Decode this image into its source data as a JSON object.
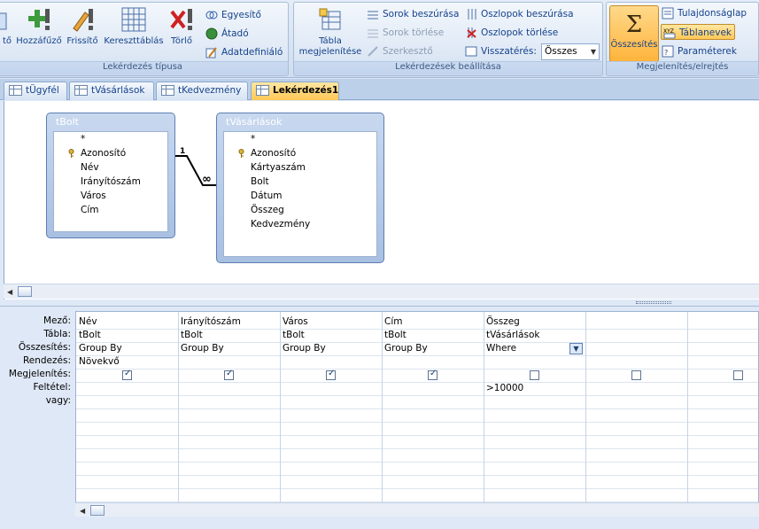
{
  "ribbon": {
    "group1": {
      "label": "Lekérdezés típusa",
      "buttons": [
        "tő",
        "Hozzáfűző",
        "Frissítő",
        "Kereszttáblás",
        "Törlő"
      ],
      "small": [
        "Egyesítő",
        "Átadó",
        "Adatdefiniáló"
      ]
    },
    "group2": {
      "label": "Lekérdezések beállítása",
      "big": "Tábla megjelenítése",
      "big_line1": "Tábla",
      "big_line2": "megjelenítése",
      "small": [
        "Sorok beszúrása",
        "Sorok törlése",
        "Szerkesztő",
        "Oszlopok beszúrása",
        "Oszlopok törlése",
        "Visszatérés:"
      ],
      "return_value": "Összes"
    },
    "group3": {
      "label": "Megjelenítés/elrejtés",
      "big": "Összesítés",
      "small": [
        "Tulajdonságlap",
        "Táblanevek",
        "Paraméterek"
      ]
    }
  },
  "tabs": [
    "tÜgyfél",
    "tVásárlások",
    "tKedvezmény",
    "Lekérdezés1"
  ],
  "tables": {
    "tBolt": {
      "title": "tBolt",
      "fields": [
        "*",
        "Azonosító",
        "Név",
        "Irányítószám",
        "Város",
        "Cím"
      ]
    },
    "tVasarlasok": {
      "title": "tVásárlások",
      "fields": [
        "*",
        "Azonosító",
        "Kártyaszám",
        "Bolt",
        "Dátum",
        "Összeg",
        "Kedvezmény"
      ]
    }
  },
  "relation": {
    "one": "1",
    "many": "∞"
  },
  "grid": {
    "row_labels": [
      "Mező:",
      "Tábla:",
      "Összesítés:",
      "Rendezés:",
      "Megjelenítés:",
      "Feltétel:",
      "vagy:"
    ],
    "columns": [
      {
        "field": "Név",
        "table": "tBolt",
        "total": "Group By",
        "sort": "Növekvő",
        "show": true,
        "criteria": ""
      },
      {
        "field": "Irányítószám",
        "table": "tBolt",
        "total": "Group By",
        "sort": "",
        "show": true,
        "criteria": ""
      },
      {
        "field": "Város",
        "table": "tBolt",
        "total": "Group By",
        "sort": "",
        "show": true,
        "criteria": ""
      },
      {
        "field": "Cím",
        "table": "tBolt",
        "total": "Group By",
        "sort": "",
        "show": true,
        "criteria": ""
      },
      {
        "field": "Összeg",
        "table": "tVásárlások",
        "total": "Where",
        "sort": "",
        "show": false,
        "criteria": ">10000"
      },
      {
        "field": "",
        "table": "",
        "total": "",
        "sort": "",
        "show": false,
        "criteria": ""
      },
      {
        "field": "",
        "table": "",
        "total": "",
        "sort": "",
        "show": false,
        "criteria": ""
      }
    ]
  },
  "colors": {
    "accent": "#ffc856",
    "ribbon_text": "#15428b"
  }
}
